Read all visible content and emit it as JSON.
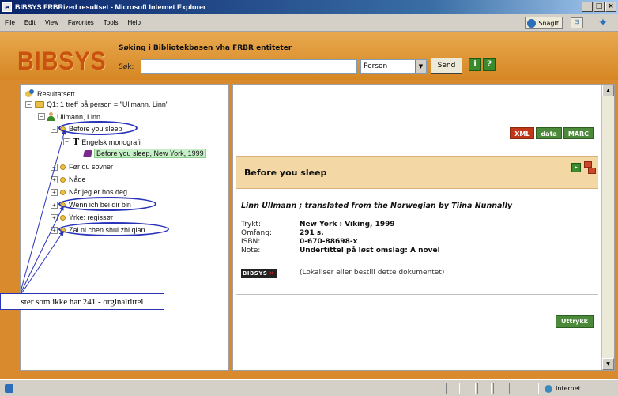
{
  "window": {
    "title": "BIBSYS FRBRized resultset - Microsoft Internet Explorer",
    "app_icon": "ie-page-icon",
    "buttons": [
      "_",
      "□",
      "×"
    ]
  },
  "menu": {
    "items": [
      "File",
      "Edit",
      "View",
      "Favorites",
      "Tools",
      "Help"
    ],
    "snagit_label": "SnagIt",
    "snagit_window_label": "⊡"
  },
  "header": {
    "logo": "BIBSYS",
    "search_heading": "Søking i Bibliotekbasen vha FRBR entiteter",
    "search_label": "Søk:",
    "search_value": "",
    "select_value": "Person",
    "send_label": "Send",
    "info_label": "i",
    "help_label": "?"
  },
  "tree": {
    "root": "Resultatsett",
    "query": "Q1: 1 treff på person = \"Ullmann, Linn\"",
    "person": "Ullmann, Linn",
    "works": [
      "Before you sleep",
      "Engelsk monografi",
      "Before you sleep, New York, 1999",
      "Før du sovner",
      "Nåde",
      "Når jeg er hos deg",
      "Wenn ich bei dir bin",
      "Yrke: regissør",
      "Zai ni chen shui zhi qian"
    ]
  },
  "annotation": {
    "text": "ster som ikke har 241 - orginaltittel"
  },
  "detail": {
    "format_buttons": [
      "XML",
      "data",
      "MARC"
    ],
    "title": "Before you sleep",
    "statement": "Linn Ullmann ; translated from the Norwegian by Tiina Nunnally",
    "fields": [
      {
        "label": "Trykt:",
        "value": "New York : Viking, 1999"
      },
      {
        "label": "Omfang:",
        "value": "291 s."
      },
      {
        "label": "ISBN:",
        "value": "0-670-88698-x"
      },
      {
        "label": "Note:",
        "value": "Undertittel på løst omslag: A novel"
      }
    ],
    "bibsys_mini": "BIBSYS",
    "bibsys_mini_x": "✕",
    "locate_link": "(Lokaliser eller bestill dette dokumentet)",
    "uttrykk_label": "Uttrykk"
  },
  "status": {
    "zone": "Internet"
  }
}
